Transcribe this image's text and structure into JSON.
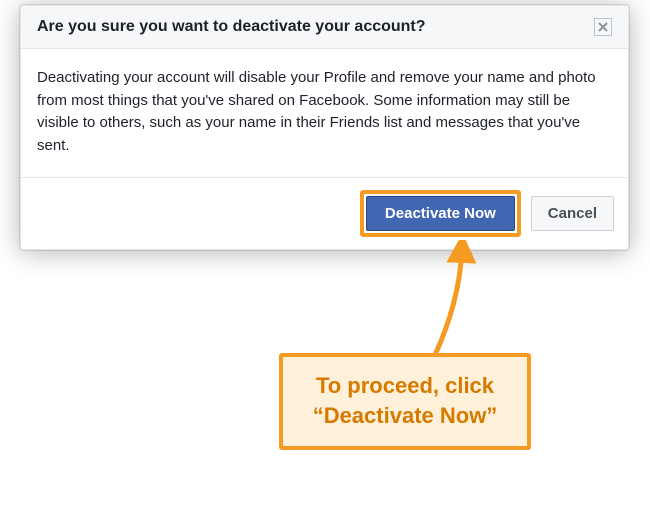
{
  "dialog": {
    "title": "Are you sure you want to deactivate your account?",
    "body": "Deactivating your account will disable your Profile and remove your name and photo from most things that you've shared on Facebook. Some information may still be visible to others, such as your name in their Friends list and messages that you've sent.",
    "primary_button": "Deactivate Now",
    "secondary_button": "Cancel"
  },
  "annotation": {
    "callout_text": "To proceed, click “Deactivate Now”"
  },
  "colors": {
    "highlight": "#f59b23",
    "primary_button_bg": "#4267b2"
  }
}
